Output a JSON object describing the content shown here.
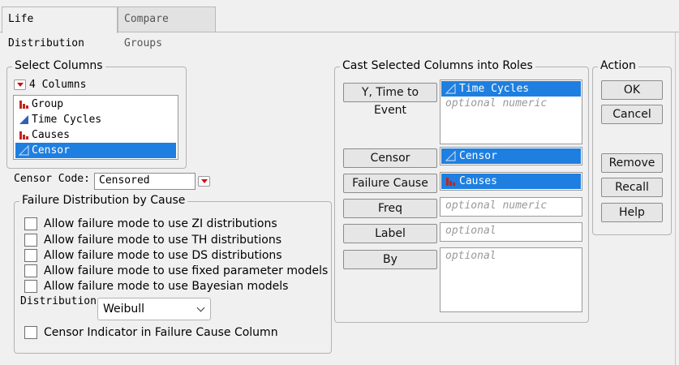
{
  "tabs": [
    {
      "label": "Life Distribution"
    },
    {
      "label": "Compare Groups"
    }
  ],
  "select_columns": {
    "title": "Select Columns",
    "count_label": "4 Columns",
    "columns": [
      {
        "name": "Group",
        "icon": "nominal-bar-icon",
        "selected": false
      },
      {
        "name": "Time Cycles",
        "icon": "continuous-triangle-icon",
        "selected": false
      },
      {
        "name": "Causes",
        "icon": "nominal-bar-icon",
        "selected": false
      },
      {
        "name": "Censor",
        "icon": "continuous-triangle-icon",
        "selected": true
      }
    ]
  },
  "censor_code": {
    "label": "Censor Code:",
    "value": "Censored"
  },
  "failure_dist": {
    "title": "Failure Distribution by Cause",
    "options": [
      {
        "label": "Allow failure mode to use ZI distributions",
        "checked": false
      },
      {
        "label": "Allow failure mode to use TH distributions",
        "checked": false
      },
      {
        "label": "Allow failure mode to use DS distributions",
        "checked": false
      },
      {
        "label": "Allow failure mode to use fixed parameter models",
        "checked": false
      },
      {
        "label": "Allow failure mode to use Bayesian models",
        "checked": false
      }
    ],
    "distribution_label": "Distribution",
    "distribution_value": "Weibull",
    "censor_indicator": {
      "label": "Censor Indicator in Failure Cause Column",
      "checked": false
    }
  },
  "roles": {
    "title": "Cast Selected Columns into Roles",
    "items": [
      {
        "button": "Y, Time to Event",
        "assigned": "Time Cycles",
        "placeholder": "optional numeric"
      },
      {
        "button": "Censor",
        "assigned": "Censor",
        "placeholder": ""
      },
      {
        "button": "Failure Cause",
        "assigned": "Causes",
        "placeholder": ""
      },
      {
        "button": "Freq",
        "assigned": "",
        "placeholder": "optional numeric"
      },
      {
        "button": "Label",
        "assigned": "",
        "placeholder": "optional"
      },
      {
        "button": "By",
        "assigned": "",
        "placeholder": "optional"
      }
    ]
  },
  "action": {
    "title": "Action",
    "buttons": [
      "OK",
      "Cancel",
      "Remove",
      "Recall",
      "Help"
    ]
  },
  "colors": {
    "selection": "#1e7fe0",
    "nominal_icon": "#c0271c",
    "continuous_icon": "#2f5fb8"
  }
}
